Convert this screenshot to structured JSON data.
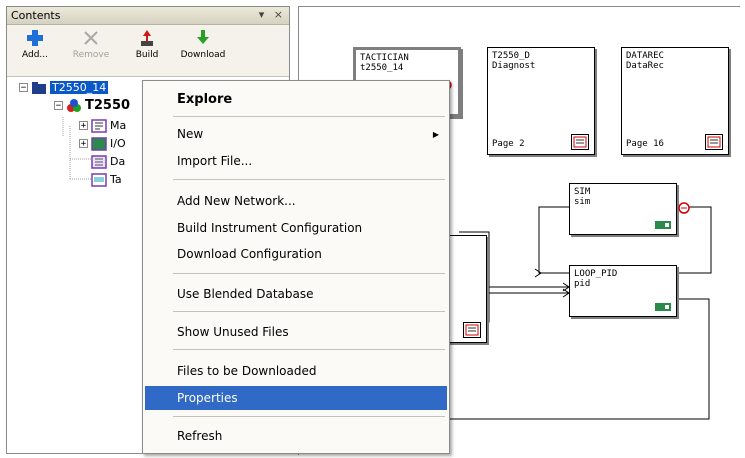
{
  "panel": {
    "title": "Contents",
    "controls": [
      "▾",
      "×"
    ],
    "toolbar": [
      {
        "label": "Add...",
        "icon": "add-icon",
        "enabled": true
      },
      {
        "label": "Remove",
        "icon": "remove-icon",
        "enabled": false
      },
      {
        "label": "Build",
        "icon": "build-icon",
        "enabled": true
      },
      {
        "label": "Download",
        "icon": "download-icon",
        "enabled": true
      }
    ]
  },
  "tree": {
    "root": "T2550_14",
    "child": "T2550",
    "items": [
      "Ma",
      "I/O",
      "Da",
      "Ta"
    ]
  },
  "menu": {
    "items": [
      {
        "label": "Explore",
        "bold": true
      },
      {
        "label": "New",
        "submenu": true
      },
      {
        "label": "Import File..."
      },
      {
        "label": "Add New Network..."
      },
      {
        "label": "Build Instrument Configuration"
      },
      {
        "label": "Download Configuration"
      },
      {
        "label": "Use Blended Database"
      },
      {
        "label": "Show Unused Files"
      },
      {
        "label": "Files to be Downloaded"
      },
      {
        "label": "Properties",
        "highlighted": true
      },
      {
        "label": "Refresh"
      }
    ]
  },
  "diagram": {
    "blocks": [
      {
        "line1": "TACTICIAN",
        "line2": "t2550_14"
      },
      {
        "line1": "T2550_D",
        "line2": "Diagnost",
        "page": "Page 2"
      },
      {
        "line1": "DATAREC",
        "line2": "DataRec",
        "page": "Page 16"
      },
      {
        "line1": "SIM",
        "line2": "sim"
      },
      {
        "line1": "LOOP_PID",
        "line2": "pid"
      }
    ]
  },
  "colors": {
    "selection": "#0a58c8",
    "menu_highlight": "#3169c6",
    "connector_red": "#d00000"
  }
}
